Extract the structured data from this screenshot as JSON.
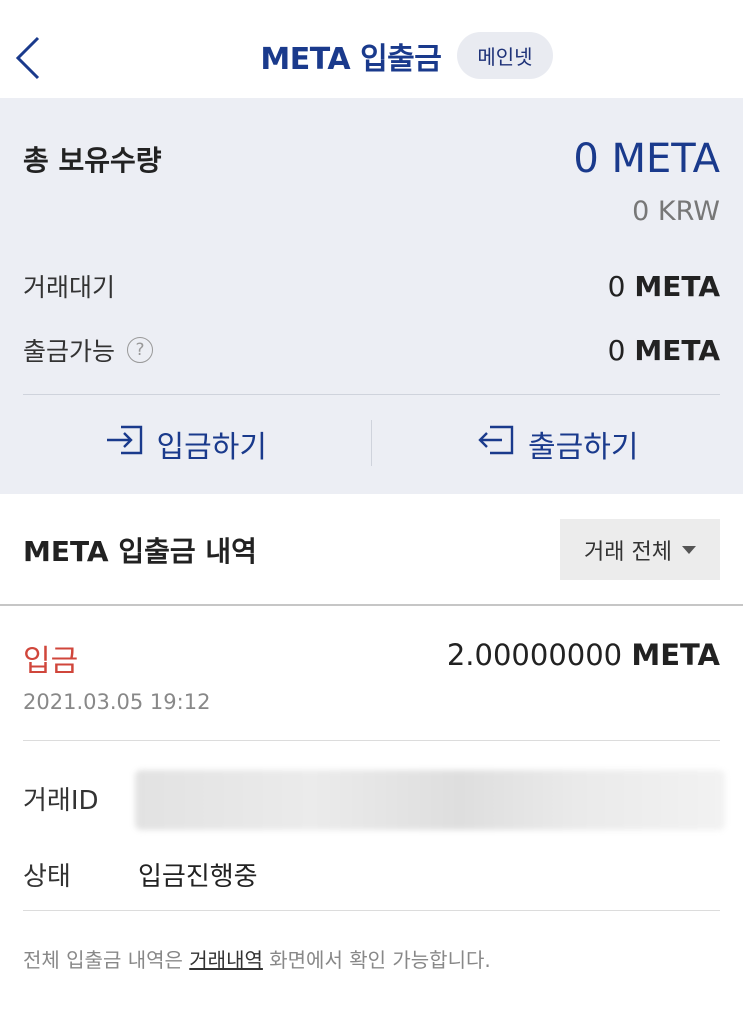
{
  "header": {
    "title": "META 입출금",
    "badge": "메인넷"
  },
  "summary": {
    "total_label": "총 보유수량",
    "total_value": "0 META",
    "krw_value": "0 KRW",
    "pending_label": "거래대기",
    "pending_amount": "0",
    "pending_unit": "META",
    "available_label": "출금가능",
    "available_amount": "0",
    "available_unit": "META",
    "help_icon_text": "?",
    "deposit_label": "입금하기",
    "withdraw_label": "출금하기"
  },
  "history": {
    "title": "META 입출금 내역",
    "filter_label": "거래 전체"
  },
  "transaction": {
    "type": "입금",
    "amount_value": "2.00000000",
    "amount_unit": "META",
    "datetime": "2021.03.05 19:12",
    "txid_label": "거래ID",
    "status_label": "상태",
    "status_value": "입금진행중"
  },
  "footnote": {
    "prefix": "전체 입출금 내역은 ",
    "link": "거래내역",
    "suffix": " 화면에서 확인 가능합니다."
  },
  "colors": {
    "accent": "#1a3a8c",
    "deposit_red": "#d0463b",
    "summary_bg": "#eceef4"
  }
}
